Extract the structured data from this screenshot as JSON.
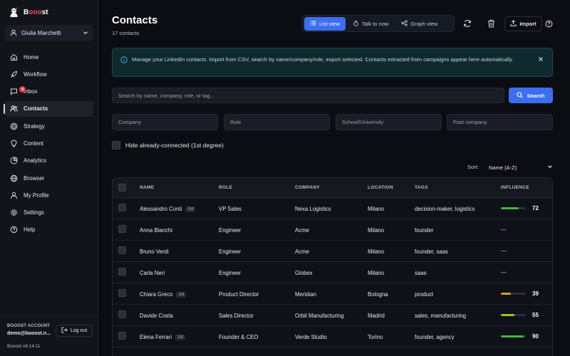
{
  "app": {
    "name_prefix": "B",
    "name_accent": "ooo",
    "name_suffix": "st",
    "user": "Giulia Marchetti"
  },
  "sidebar": {
    "items": [
      {
        "label": "Home",
        "icon": "home-icon",
        "active": false
      },
      {
        "label": "Workflow",
        "icon": "rocket-icon",
        "active": false
      },
      {
        "label": "Inbox",
        "icon": "inbox-icon",
        "active": false,
        "badge": "4"
      },
      {
        "label": "Contacts",
        "icon": "users-icon",
        "active": true
      },
      {
        "label": "Strategy",
        "icon": "target-icon",
        "active": false
      },
      {
        "label": "Content",
        "icon": "lightbulb-icon",
        "active": false
      },
      {
        "label": "Analytics",
        "icon": "analytics-icon",
        "active": false
      },
      {
        "label": "Browser",
        "icon": "globe-icon",
        "active": false
      },
      {
        "label": "My Profile",
        "icon": "user-icon",
        "active": false
      },
      {
        "label": "Settings",
        "icon": "gear-icon",
        "active": false
      },
      {
        "label": "Help",
        "icon": "help-icon",
        "active": false
      }
    ],
    "account_label": "BOOOST ACCOUNT",
    "account_email": "demo@booost.n...",
    "logout_label": "Log out",
    "version": "Booost v9.14.11"
  },
  "header": {
    "title": "Contacts",
    "subtitle": "17 contacts",
    "views": [
      {
        "label": "List view",
        "icon": "list-icon",
        "active": true
      },
      {
        "label": "Talk to now",
        "icon": "flame-icon",
        "active": false
      },
      {
        "label": "Graph view",
        "icon": "graph-icon",
        "active": false
      }
    ],
    "import_label": "Import"
  },
  "banner": {
    "text": "Manage your LinkedIn contacts. Import from CSV, search by name/company/role, export selected. Contacts extracted from campaigns appear here automatically."
  },
  "search": {
    "placeholder": "Search by name, company, role, or tag...",
    "button_label": "Search"
  },
  "filters": {
    "company": "Company",
    "role": "Role",
    "school": "School/University",
    "past_company": "Past company"
  },
  "hide_connected_label": "Hide already-connected (1st degree)",
  "sort": {
    "label": "Sort:",
    "value": "Name (A-Z)"
  },
  "colors": {
    "accent": "#3b6ef0",
    "influence_high": "#3fb83f",
    "influence_mid": "#9fc42b",
    "influence_low": "#d1a41f"
  },
  "table": {
    "columns": [
      "NAME",
      "ROLE",
      "COMPANY",
      "LOCATION",
      "TAGS",
      "INFLUENCE"
    ],
    "rows": [
      {
        "name": "Alessandro Conti",
        "degree": "1st",
        "role": "VP Sales",
        "company": "Nexa Logistics",
        "location": "Milano",
        "tags": "decision-maker, logistics",
        "influence": 72
      },
      {
        "name": "Anna Bianchi",
        "degree": "",
        "role": "Engineer",
        "company": "Acme",
        "location": "Milano",
        "tags": "founder",
        "influence": null
      },
      {
        "name": "Bruno Verdi",
        "degree": "",
        "role": "Engineer",
        "company": "Acme",
        "location": "Milano",
        "tags": "founder, saas",
        "influence": null
      },
      {
        "name": "Carla Neri",
        "degree": "",
        "role": "Engineer",
        "company": "Globex",
        "location": "Milano",
        "tags": "saas",
        "influence": null
      },
      {
        "name": "Chiara Greco",
        "degree": "1st",
        "role": "Product Director",
        "company": "Meridian",
        "location": "Bologna",
        "tags": "product",
        "influence": 39
      },
      {
        "name": "Davide Costa",
        "degree": "",
        "role": "Sales Director",
        "company": "Orbit Manufacturing",
        "location": "Madrid",
        "tags": "sales, manufacturing",
        "influence": 55
      },
      {
        "name": "Elena Ferrari",
        "degree": "1st",
        "role": "Founder & CEO",
        "company": "Verde Studio",
        "location": "Torino",
        "tags": "founder, agency",
        "influence": 90
      }
    ],
    "empty_influence": "—"
  }
}
